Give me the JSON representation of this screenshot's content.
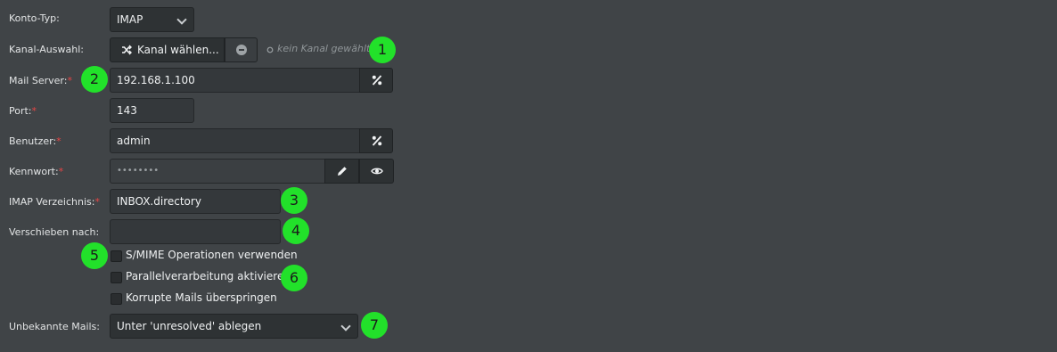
{
  "form": {
    "account_type": {
      "label": "Konto-Typ:",
      "value": "IMAP"
    },
    "channel": {
      "label": "Kanal-Auswahl:",
      "button_label": "Kanal wählen...",
      "status": "kein Kanal gewählt"
    },
    "mail_server": {
      "label": "Mail Server:",
      "required_mark": "*",
      "value": "192.168.1.100"
    },
    "port": {
      "label": "Port:",
      "required_mark": "*",
      "value": "143"
    },
    "user": {
      "label": "Benutzer:",
      "required_mark": "*",
      "value": "admin"
    },
    "password": {
      "label": "Kennwort:",
      "required_mark": "*",
      "value": "••••••••"
    },
    "imap_directory": {
      "label": "IMAP Verzeichnis:",
      "required_mark": "*",
      "value": "INBOX.directory"
    },
    "move_to": {
      "label": "Verschieben nach:",
      "value": ""
    },
    "checkboxes": [
      {
        "label": "S/MIME Operationen verwenden",
        "checked": false
      },
      {
        "label": "Parallelverarbeitung aktivieren",
        "checked": false
      },
      {
        "label": "Korrupte Mails überspringen",
        "checked": false
      }
    ],
    "unknown_mails": {
      "label": "Unbekannte Mails:",
      "value": "Unter 'unresolved' ablegen"
    }
  },
  "annotations": [
    "1",
    "2",
    "3",
    "4",
    "5",
    "6",
    "7"
  ],
  "colors": {
    "background": "#404447",
    "input_bg": "#34383b",
    "required": "#e84646",
    "badge": "#22e12a"
  },
  "icons": [
    "shuffle-icon",
    "minus-circle-icon",
    "circle-outline-icon",
    "percent-icon",
    "pencil-icon",
    "eye-icon",
    "chevron-down-icon"
  ]
}
